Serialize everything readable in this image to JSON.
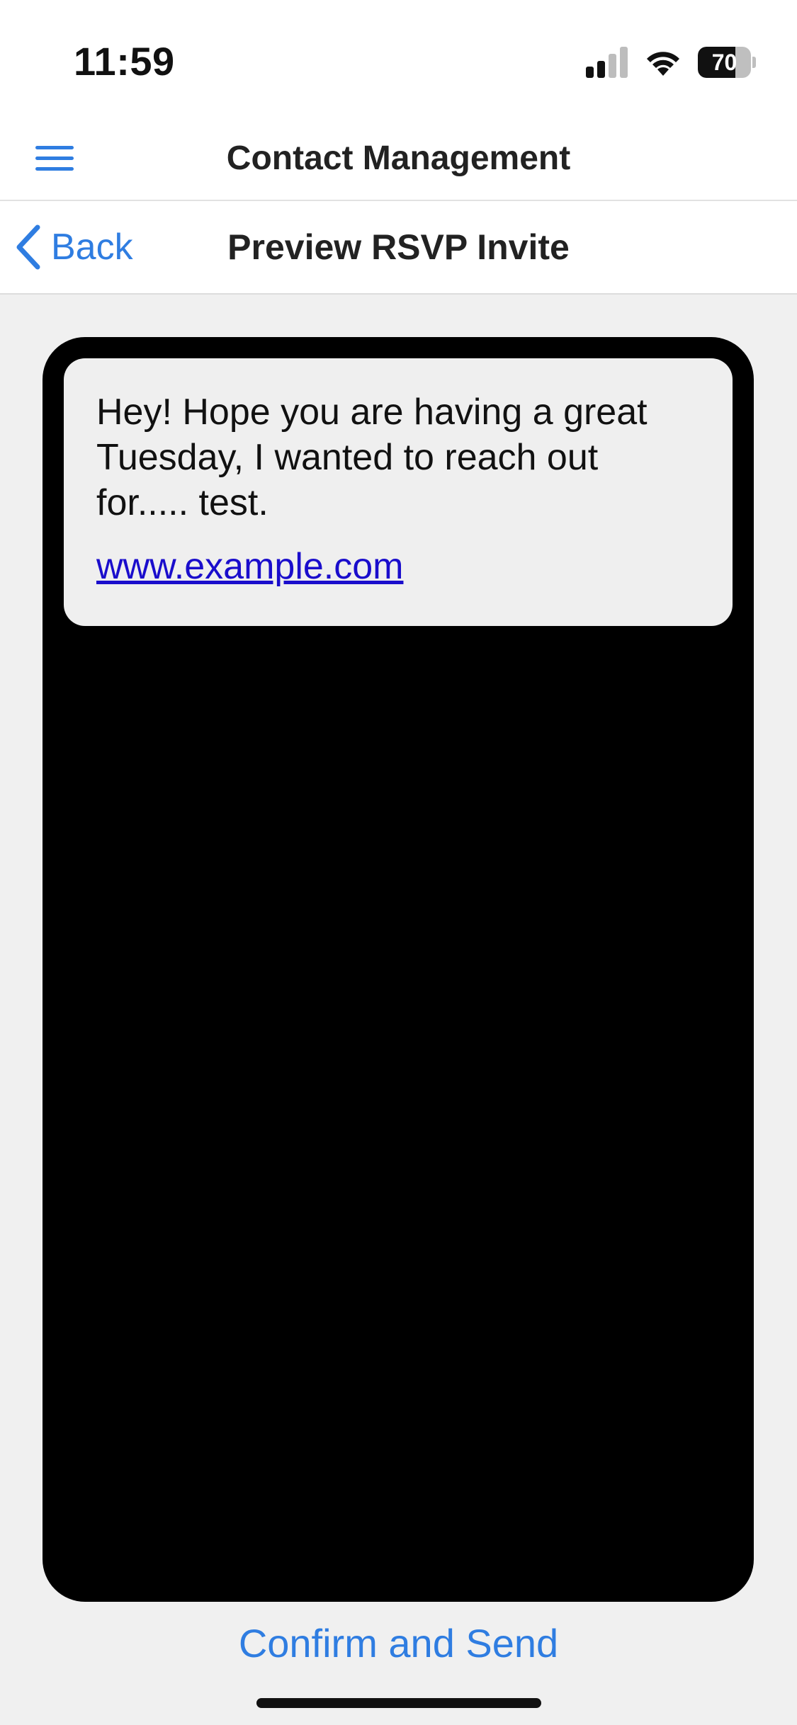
{
  "status_bar": {
    "time": "11:59",
    "battery_level": "70",
    "battery_fraction": 0.7,
    "signal_icon": "cellular-signal-icon",
    "wifi_icon": "wifi-icon"
  },
  "header": {
    "menu_icon": "hamburger-menu-icon",
    "title": "Contact Management"
  },
  "nav": {
    "back_icon": "chevron-left-icon",
    "back_label": "Back",
    "title": "Preview RSVP Invite"
  },
  "preview": {
    "message": "Hey! Hope you are having a great Tuesday, I wanted to reach out for..... test.",
    "link": "www.example.com"
  },
  "actions": {
    "confirm_label": "Confirm and Send"
  },
  "colors": {
    "accent": "#2f7de1",
    "link": "#1a0dcc",
    "background": "#f0f0f0",
    "frame": "#000000",
    "bubble": "#efefef"
  }
}
